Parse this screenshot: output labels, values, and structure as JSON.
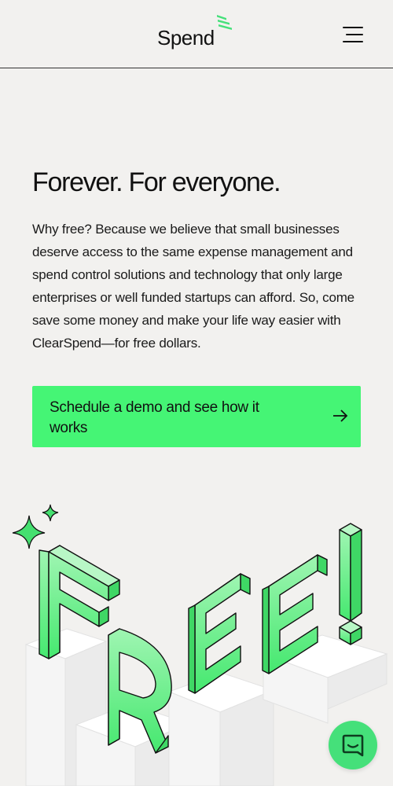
{
  "header": {
    "logo_text": "Spend",
    "menu_icon": "hamburger-menu-icon"
  },
  "hero": {
    "title": "Forever. For everyone.",
    "body": "Why free? Because we believe that small businesses deserve access to the same expense management and spend control solutions and technology that only large enterprises or well funded startups can afford. So, come save some money and make your life way easier with ClearSpend—for free dollars.",
    "cta_label": "Schedule a demo and see how it works",
    "cta_icon": "arrow-right-icon"
  },
  "illustration": {
    "letters": [
      "F",
      "R",
      "E",
      "E",
      "!"
    ],
    "icon": "sparkle-icon"
  },
  "chat": {
    "icon": "chat-bubble-icon"
  },
  "colors": {
    "accent": "#45f575",
    "background": "#f2f1ef",
    "text": "#111111"
  }
}
